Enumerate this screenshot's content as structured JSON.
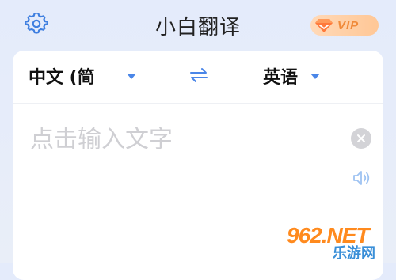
{
  "header": {
    "settings_icon": "gear-icon",
    "title": "小白翻译",
    "vip_label": "VIP",
    "vip_icon": "diamond-icon"
  },
  "languages": {
    "source": "中文 (简",
    "target": "英语",
    "swap_icon": "swap-arrows-icon",
    "dropdown_icon": "caret-down-icon"
  },
  "input": {
    "placeholder": "点击输入文字",
    "value": "",
    "clear_icon": "close-circle-icon",
    "speaker_icon": "speaker-icon"
  },
  "watermark": {
    "logo": "962.NET",
    "sub": "乐游网"
  },
  "colors": {
    "accent": "#4a86e8",
    "background": "#e6ecfa",
    "vip_bg": "#ffc796",
    "vip_text": "#f08a3a",
    "placeholder": "#cfcfd3"
  }
}
